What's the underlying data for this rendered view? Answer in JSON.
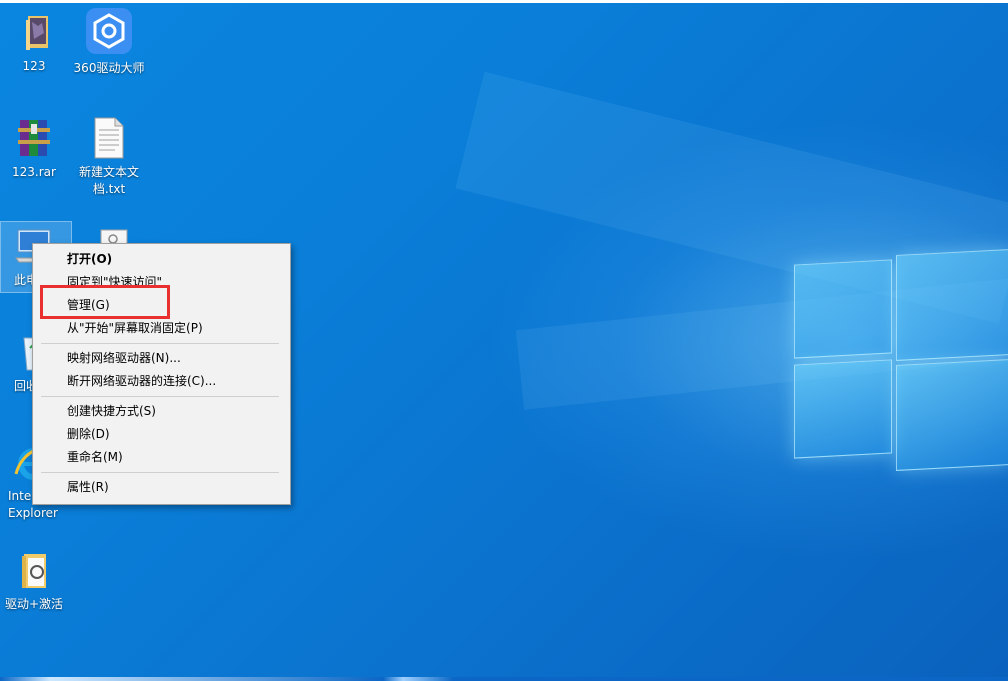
{
  "desktop": {
    "icons": [
      {
        "label": "123",
        "icon": "folder-icon"
      },
      {
        "label": "360驱动大师",
        "icon": "driver-master-icon"
      },
      {
        "label": "123.rar",
        "icon": "winrar-archive-icon"
      },
      {
        "label": "新建文本文\n档.txt",
        "icon": "text-file-icon"
      },
      {
        "label": "此电",
        "icon": "this-pc-icon"
      },
      {
        "label": "回收",
        "icon": "recycle-bin-icon"
      },
      {
        "label": "Inte\nExplorer",
        "icon": "internet-explorer-icon"
      },
      {
        "label": "驱动+激活",
        "icon": "folder-icon"
      }
    ]
  },
  "context_menu": {
    "items": [
      {
        "label": "打开(O)",
        "bold": true
      },
      {
        "label": "固定到\"快速访问\""
      },
      {
        "label": "管理(G)"
      },
      {
        "label": "从\"开始\"屏幕取消固定(P)"
      },
      {
        "label": "映射网络驱动器(N)..."
      },
      {
        "label": "断开网络驱动器的连接(C)..."
      },
      {
        "label": "创建快捷方式(S)"
      },
      {
        "label": "删除(D)"
      },
      {
        "label": "重命名(M)"
      },
      {
        "label": "属性(R)"
      }
    ]
  },
  "colors": {
    "highlight_border": "#e8302e",
    "desktop_blue": "#0a7ed8",
    "menu_background": "#f2f2f2"
  }
}
